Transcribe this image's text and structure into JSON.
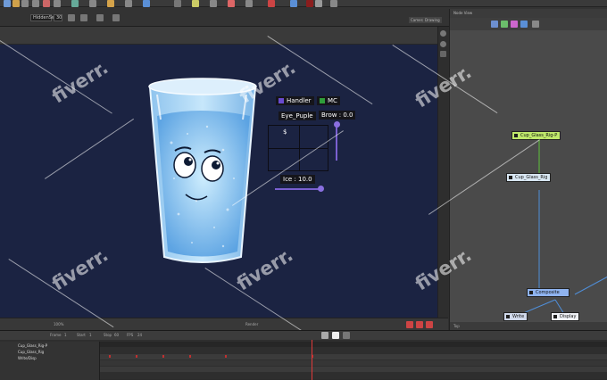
{
  "toolbar": {
    "mode_dropdown": "HiddenSwap",
    "frame_input": "30",
    "tabs": [
      "Camera",
      "Drawing"
    ]
  },
  "controls": {
    "handler_label": "Handler",
    "mc_label": "MC",
    "eye_label": "Eye_Puple",
    "brow_label": "Brow : 0.0",
    "ice_label": "Ice : 10.0",
    "pad_marker": "$",
    "handler_color": "#6a4bd0",
    "mc_color": "#2f9e3a",
    "slider_color": "#7a60d0",
    "brow_value": 0.0,
    "ice_value": 10.0
  },
  "viewport_footer": {
    "zoom": "100%",
    "view": "Render"
  },
  "node_view": {
    "title": "Node View",
    "nodes": [
      {
        "label": "Cup_Glass_Rig-P",
        "color": "#bfe86b"
      },
      {
        "label": "Cup_Glass_Rig",
        "color": "#d8e6f2"
      },
      {
        "label": "Composite",
        "color": "#8fb3ef"
      },
      {
        "label": "Write",
        "color": "#cfd8ea"
      },
      {
        "label": "Display",
        "color": "#eef0f4"
      }
    ],
    "footer": "Top"
  },
  "timeline": {
    "frame_label": "Frame",
    "start_label": "Start",
    "stop_label": "Stop",
    "fps_label": "FPS",
    "frame_value": "1",
    "start_value": "1",
    "stop_value": "60",
    "fps_value": "24",
    "layers": [
      "Cup_Glass_Rig-P",
      "Cup_Glass_Rig",
      "Write/Disp"
    ]
  },
  "watermark": "fiverr."
}
